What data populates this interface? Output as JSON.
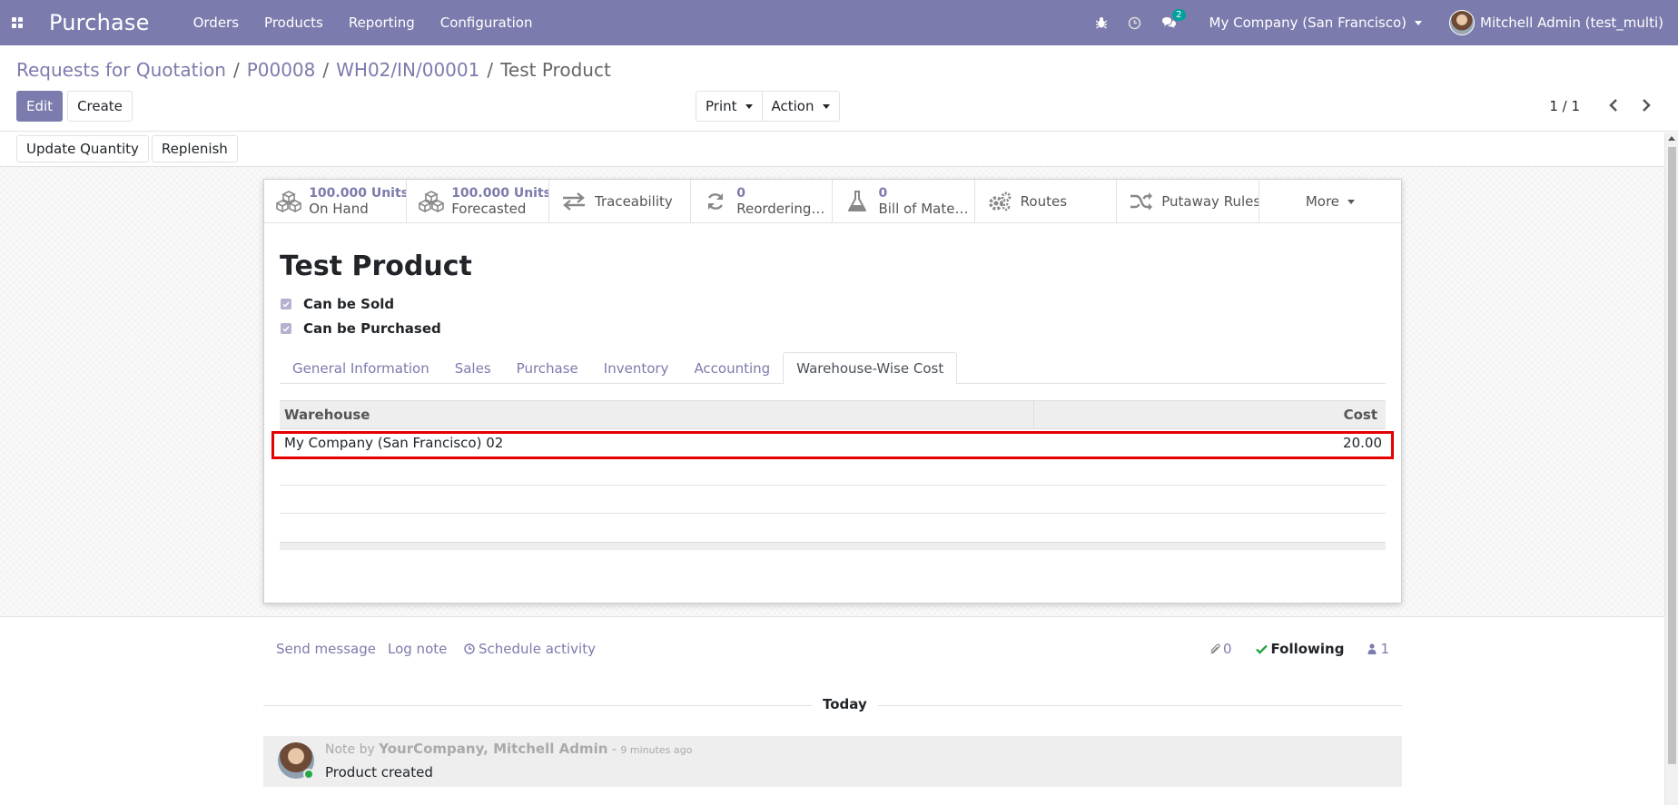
{
  "navbar": {
    "app_name": "Purchase",
    "menu": [
      "Orders",
      "Products",
      "Reporting",
      "Configuration"
    ],
    "chat_badge": "2",
    "company": "My Company (San Francisco)",
    "user": "Mitchell Admin (test_multi)"
  },
  "breadcrumb": {
    "items": [
      "Requests for Quotation",
      "P00008",
      "WH02/IN/00001"
    ],
    "current": "Test Product",
    "separator": "/"
  },
  "control": {
    "edit_label": "Edit",
    "create_label": "Create",
    "print_label": "Print",
    "action_label": "Action",
    "pager": "1 / 1"
  },
  "statusbar": {
    "update_qty_label": "Update Quantity",
    "replenish_label": "Replenish"
  },
  "smart_buttons": {
    "on_hand_value": "100.000 Units",
    "on_hand_label": "On Hand",
    "forecast_value": "100.000 Units",
    "forecast_label": "Forecasted",
    "traceability_label": "Traceability",
    "reordering_value": "0",
    "reordering_label": "Reordering …",
    "bom_value": "0",
    "bom_label": "Bill of Materi…",
    "routes_label": "Routes",
    "putaway_label": "Putaway Rules",
    "more_label": "More"
  },
  "product": {
    "name": "Test Product",
    "can_be_sold_label": "Can be Sold",
    "can_be_sold": true,
    "can_be_purchased_label": "Can be Purchased",
    "can_be_purchased": true
  },
  "tabs": [
    "General Information",
    "Sales",
    "Purchase",
    "Inventory",
    "Accounting",
    "Warehouse-Wise Cost"
  ],
  "active_tab": "Warehouse-Wise Cost",
  "cost_table": {
    "headers": {
      "warehouse": "Warehouse",
      "cost": "Cost"
    },
    "rows": [
      {
        "warehouse": "My Company (San Francisco) 02",
        "cost": "20.00"
      }
    ]
  },
  "chatter": {
    "send_message": "Send message",
    "log_note": "Log note",
    "schedule_activity": "Schedule activity",
    "attachments_count": "0",
    "following_label": "Following",
    "followers_count": "1",
    "date_divider": "Today",
    "message": {
      "prefix": "Note by",
      "author": "YourCompany, Mitchell Admin",
      "time": "9 minutes ago",
      "body": "Product created"
    }
  },
  "colors": {
    "brand": "#7c7bad",
    "highlight": "#e50000"
  }
}
